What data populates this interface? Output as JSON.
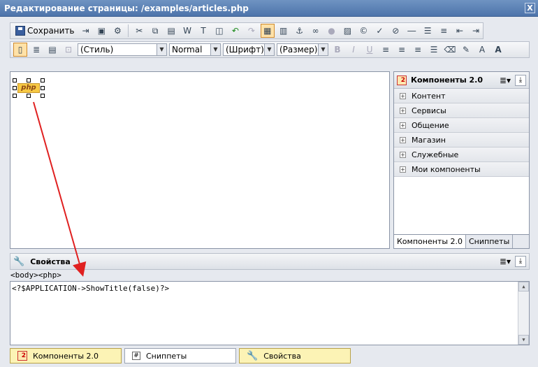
{
  "window": {
    "title": "Редактирование страницы: /examples/articles.php",
    "close": "X"
  },
  "toolbar": {
    "save_label": "Сохранить",
    "style_select": "(Стиль)",
    "format_select": "Normal",
    "font_select": "(Шрифт)",
    "size_select": "(Размер)"
  },
  "editor": {
    "php_label": "php"
  },
  "components_panel": {
    "title": "Компоненты 2.0",
    "categories": [
      "Контент",
      "Сервисы",
      "Общение",
      "Магазин",
      "Служебные",
      "Мои компоненты"
    ],
    "tabs": [
      "Компоненты 2.0",
      "Сниппеты"
    ]
  },
  "properties": {
    "title": "Свойства",
    "path": "<body><php>",
    "code": "<?$APPLICATION->ShowTitle(false)?>"
  },
  "bottom_tabs": [
    "Компоненты 2.0",
    "Сниппеты",
    "Свойства"
  ],
  "colors": {
    "titlebar": "#5a7fb3",
    "arrow": "#e02020",
    "tab_highlight": "#fcf3b5"
  }
}
